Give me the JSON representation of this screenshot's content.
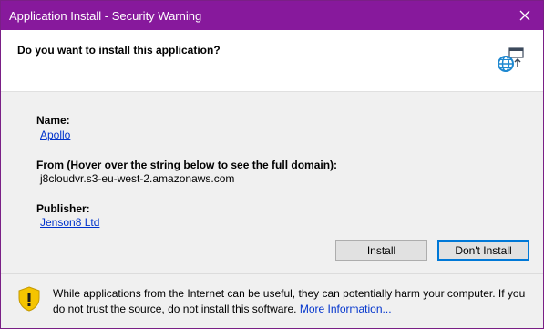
{
  "window": {
    "title": "Application Install - Security Warning"
  },
  "header": {
    "question": "Do you want to install this application?"
  },
  "details": {
    "name_label": "Name:",
    "name_value": "Apollo",
    "from_label": "From (Hover over the string below to see the full domain):",
    "from_value": "j8cloudvr.s3-eu-west-2.amazonaws.com",
    "publisher_label": "Publisher:",
    "publisher_value": "Jenson8 Ltd"
  },
  "buttons": {
    "install": "Install",
    "dont_install": "Don't Install"
  },
  "footer": {
    "warning": "While applications from the Internet can be useful, they can potentially harm your computer. If you do not trust the source, do not install this software.",
    "more_info": "More Information..."
  },
  "colors": {
    "titlebar": "#87199c",
    "link": "#0033cc",
    "default_button_border": "#0078d7",
    "shield": "#f5c400"
  },
  "icons": {
    "close": "close-icon",
    "app": "globe-install-icon",
    "warning": "warning-shield-icon"
  }
}
